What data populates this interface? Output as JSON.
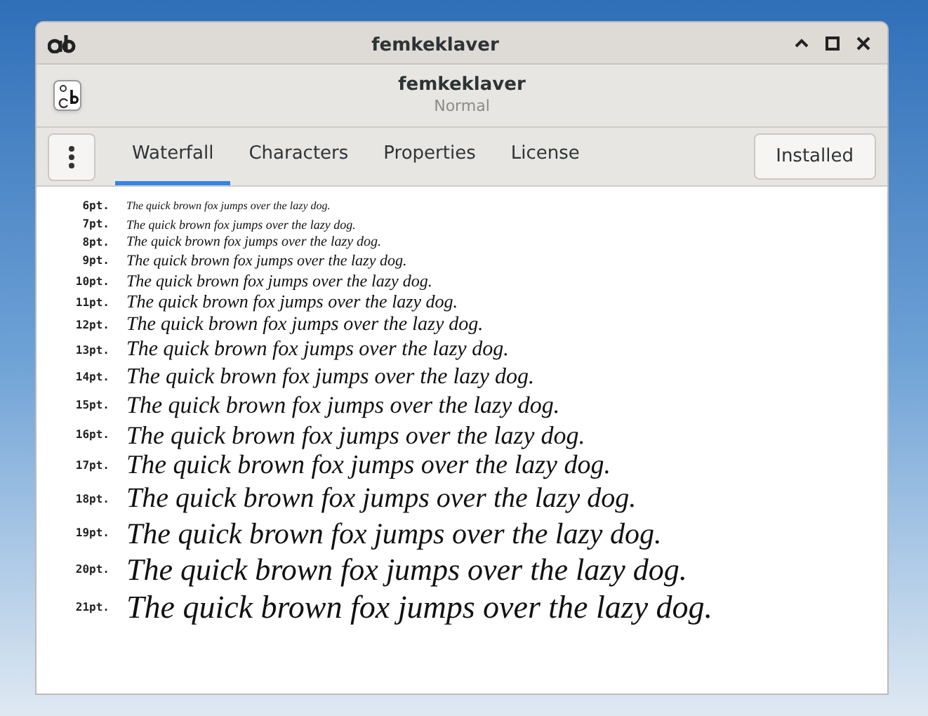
{
  "window": {
    "title": "femkeklaver"
  },
  "header": {
    "title": "femkeklaver",
    "subtitle": "Normal"
  },
  "tabs": [
    {
      "label": "Waterfall",
      "selected": true
    },
    {
      "label": "Characters",
      "selected": false
    },
    {
      "label": "Properties",
      "selected": false
    },
    {
      "label": "License",
      "selected": false
    }
  ],
  "install_button": {
    "label": "Installed"
  },
  "waterfall": [
    {
      "size": "6pt.",
      "sample": "The quick brown fox jumps over the lazy dog."
    },
    {
      "size": "7pt.",
      "sample": "The quick brown fox jumps over the lazy dog."
    },
    {
      "size": "8pt.",
      "sample": "The quick brown fox jumps over the lazy dog."
    },
    {
      "size": "9pt.",
      "sample": "The quick brown fox jumps over the lazy dog."
    },
    {
      "size": "10pt.",
      "sample": "The quick brown fox jumps over the lazy dog."
    },
    {
      "size": "11pt.",
      "sample": "The quick brown fox jumps over the lazy dog."
    },
    {
      "size": "12pt.",
      "sample": "The quick brown fox jumps over the lazy dog."
    },
    {
      "size": "13pt.",
      "sample": "The quick brown fox jumps over the lazy dog."
    },
    {
      "size": "14pt.",
      "sample": "The quick brown fox jumps over the lazy dog."
    },
    {
      "size": "15pt.",
      "sample": "The quick brown fox jumps over the lazy dog."
    },
    {
      "size": "16pt.",
      "sample": "The quick brown fox jumps over the lazy dog."
    },
    {
      "size": "17pt.",
      "sample": "The quick brown fox jumps over the lazy dog."
    },
    {
      "size": "18pt.",
      "sample": "The quick brown fox jumps over the lazy dog."
    },
    {
      "size": "19pt.",
      "sample": "The quick brown fox jumps over the lazy dog."
    },
    {
      "size": "20pt.",
      "sample": "The quick brown fox jumps over the lazy dog."
    },
    {
      "size": "21pt.",
      "sample": "The quick brown fox jumps over the lazy dog."
    }
  ]
}
